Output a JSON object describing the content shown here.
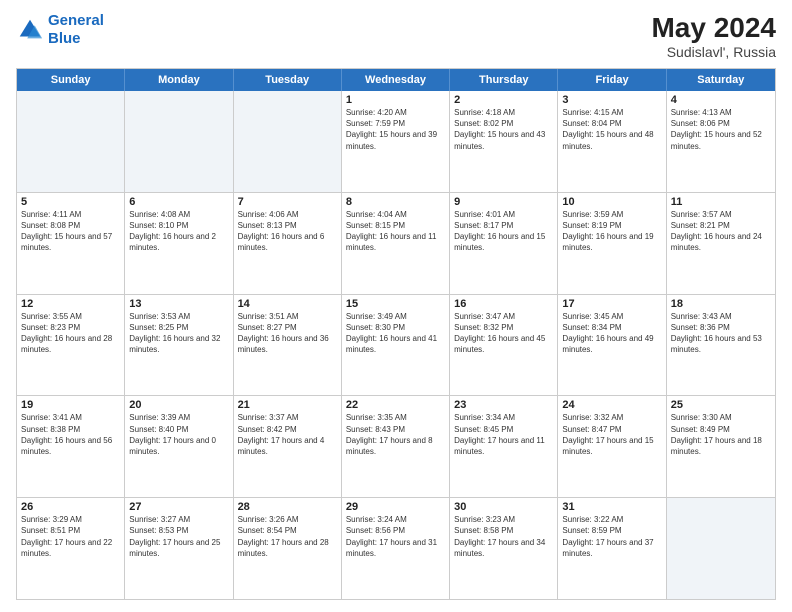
{
  "header": {
    "logo_line1": "General",
    "logo_line2": "Blue",
    "month_year": "May 2024",
    "location": "Sudislavl', Russia"
  },
  "days_of_week": [
    "Sunday",
    "Monday",
    "Tuesday",
    "Wednesday",
    "Thursday",
    "Friday",
    "Saturday"
  ],
  "weeks": [
    [
      {
        "day": "",
        "sunrise": "",
        "sunset": "",
        "daylight": "",
        "empty": true
      },
      {
        "day": "",
        "sunrise": "",
        "sunset": "",
        "daylight": "",
        "empty": true
      },
      {
        "day": "",
        "sunrise": "",
        "sunset": "",
        "daylight": "",
        "empty": true
      },
      {
        "day": "1",
        "sunrise": "Sunrise: 4:20 AM",
        "sunset": "Sunset: 7:59 PM",
        "daylight": "Daylight: 15 hours and 39 minutes.",
        "empty": false
      },
      {
        "day": "2",
        "sunrise": "Sunrise: 4:18 AM",
        "sunset": "Sunset: 8:02 PM",
        "daylight": "Daylight: 15 hours and 43 minutes.",
        "empty": false
      },
      {
        "day": "3",
        "sunrise": "Sunrise: 4:15 AM",
        "sunset": "Sunset: 8:04 PM",
        "daylight": "Daylight: 15 hours and 48 minutes.",
        "empty": false
      },
      {
        "day": "4",
        "sunrise": "Sunrise: 4:13 AM",
        "sunset": "Sunset: 8:06 PM",
        "daylight": "Daylight: 15 hours and 52 minutes.",
        "empty": false
      }
    ],
    [
      {
        "day": "5",
        "sunrise": "Sunrise: 4:11 AM",
        "sunset": "Sunset: 8:08 PM",
        "daylight": "Daylight: 15 hours and 57 minutes.",
        "empty": false
      },
      {
        "day": "6",
        "sunrise": "Sunrise: 4:08 AM",
        "sunset": "Sunset: 8:10 PM",
        "daylight": "Daylight: 16 hours and 2 minutes.",
        "empty": false
      },
      {
        "day": "7",
        "sunrise": "Sunrise: 4:06 AM",
        "sunset": "Sunset: 8:13 PM",
        "daylight": "Daylight: 16 hours and 6 minutes.",
        "empty": false
      },
      {
        "day": "8",
        "sunrise": "Sunrise: 4:04 AM",
        "sunset": "Sunset: 8:15 PM",
        "daylight": "Daylight: 16 hours and 11 minutes.",
        "empty": false
      },
      {
        "day": "9",
        "sunrise": "Sunrise: 4:01 AM",
        "sunset": "Sunset: 8:17 PM",
        "daylight": "Daylight: 16 hours and 15 minutes.",
        "empty": false
      },
      {
        "day": "10",
        "sunrise": "Sunrise: 3:59 AM",
        "sunset": "Sunset: 8:19 PM",
        "daylight": "Daylight: 16 hours and 19 minutes.",
        "empty": false
      },
      {
        "day": "11",
        "sunrise": "Sunrise: 3:57 AM",
        "sunset": "Sunset: 8:21 PM",
        "daylight": "Daylight: 16 hours and 24 minutes.",
        "empty": false
      }
    ],
    [
      {
        "day": "12",
        "sunrise": "Sunrise: 3:55 AM",
        "sunset": "Sunset: 8:23 PM",
        "daylight": "Daylight: 16 hours and 28 minutes.",
        "empty": false
      },
      {
        "day": "13",
        "sunrise": "Sunrise: 3:53 AM",
        "sunset": "Sunset: 8:25 PM",
        "daylight": "Daylight: 16 hours and 32 minutes.",
        "empty": false
      },
      {
        "day": "14",
        "sunrise": "Sunrise: 3:51 AM",
        "sunset": "Sunset: 8:27 PM",
        "daylight": "Daylight: 16 hours and 36 minutes.",
        "empty": false
      },
      {
        "day": "15",
        "sunrise": "Sunrise: 3:49 AM",
        "sunset": "Sunset: 8:30 PM",
        "daylight": "Daylight: 16 hours and 41 minutes.",
        "empty": false
      },
      {
        "day": "16",
        "sunrise": "Sunrise: 3:47 AM",
        "sunset": "Sunset: 8:32 PM",
        "daylight": "Daylight: 16 hours and 45 minutes.",
        "empty": false
      },
      {
        "day": "17",
        "sunrise": "Sunrise: 3:45 AM",
        "sunset": "Sunset: 8:34 PM",
        "daylight": "Daylight: 16 hours and 49 minutes.",
        "empty": false
      },
      {
        "day": "18",
        "sunrise": "Sunrise: 3:43 AM",
        "sunset": "Sunset: 8:36 PM",
        "daylight": "Daylight: 16 hours and 53 minutes.",
        "empty": false
      }
    ],
    [
      {
        "day": "19",
        "sunrise": "Sunrise: 3:41 AM",
        "sunset": "Sunset: 8:38 PM",
        "daylight": "Daylight: 16 hours and 56 minutes.",
        "empty": false
      },
      {
        "day": "20",
        "sunrise": "Sunrise: 3:39 AM",
        "sunset": "Sunset: 8:40 PM",
        "daylight": "Daylight: 17 hours and 0 minutes.",
        "empty": false
      },
      {
        "day": "21",
        "sunrise": "Sunrise: 3:37 AM",
        "sunset": "Sunset: 8:42 PM",
        "daylight": "Daylight: 17 hours and 4 minutes.",
        "empty": false
      },
      {
        "day": "22",
        "sunrise": "Sunrise: 3:35 AM",
        "sunset": "Sunset: 8:43 PM",
        "daylight": "Daylight: 17 hours and 8 minutes.",
        "empty": false
      },
      {
        "day": "23",
        "sunrise": "Sunrise: 3:34 AM",
        "sunset": "Sunset: 8:45 PM",
        "daylight": "Daylight: 17 hours and 11 minutes.",
        "empty": false
      },
      {
        "day": "24",
        "sunrise": "Sunrise: 3:32 AM",
        "sunset": "Sunset: 8:47 PM",
        "daylight": "Daylight: 17 hours and 15 minutes.",
        "empty": false
      },
      {
        "day": "25",
        "sunrise": "Sunrise: 3:30 AM",
        "sunset": "Sunset: 8:49 PM",
        "daylight": "Daylight: 17 hours and 18 minutes.",
        "empty": false
      }
    ],
    [
      {
        "day": "26",
        "sunrise": "Sunrise: 3:29 AM",
        "sunset": "Sunset: 8:51 PM",
        "daylight": "Daylight: 17 hours and 22 minutes.",
        "empty": false
      },
      {
        "day": "27",
        "sunrise": "Sunrise: 3:27 AM",
        "sunset": "Sunset: 8:53 PM",
        "daylight": "Daylight: 17 hours and 25 minutes.",
        "empty": false
      },
      {
        "day": "28",
        "sunrise": "Sunrise: 3:26 AM",
        "sunset": "Sunset: 8:54 PM",
        "daylight": "Daylight: 17 hours and 28 minutes.",
        "empty": false
      },
      {
        "day": "29",
        "sunrise": "Sunrise: 3:24 AM",
        "sunset": "Sunset: 8:56 PM",
        "daylight": "Daylight: 17 hours and 31 minutes.",
        "empty": false
      },
      {
        "day": "30",
        "sunrise": "Sunrise: 3:23 AM",
        "sunset": "Sunset: 8:58 PM",
        "daylight": "Daylight: 17 hours and 34 minutes.",
        "empty": false
      },
      {
        "day": "31",
        "sunrise": "Sunrise: 3:22 AM",
        "sunset": "Sunset: 8:59 PM",
        "daylight": "Daylight: 17 hours and 37 minutes.",
        "empty": false
      },
      {
        "day": "",
        "sunrise": "",
        "sunset": "",
        "daylight": "",
        "empty": true
      }
    ]
  ]
}
